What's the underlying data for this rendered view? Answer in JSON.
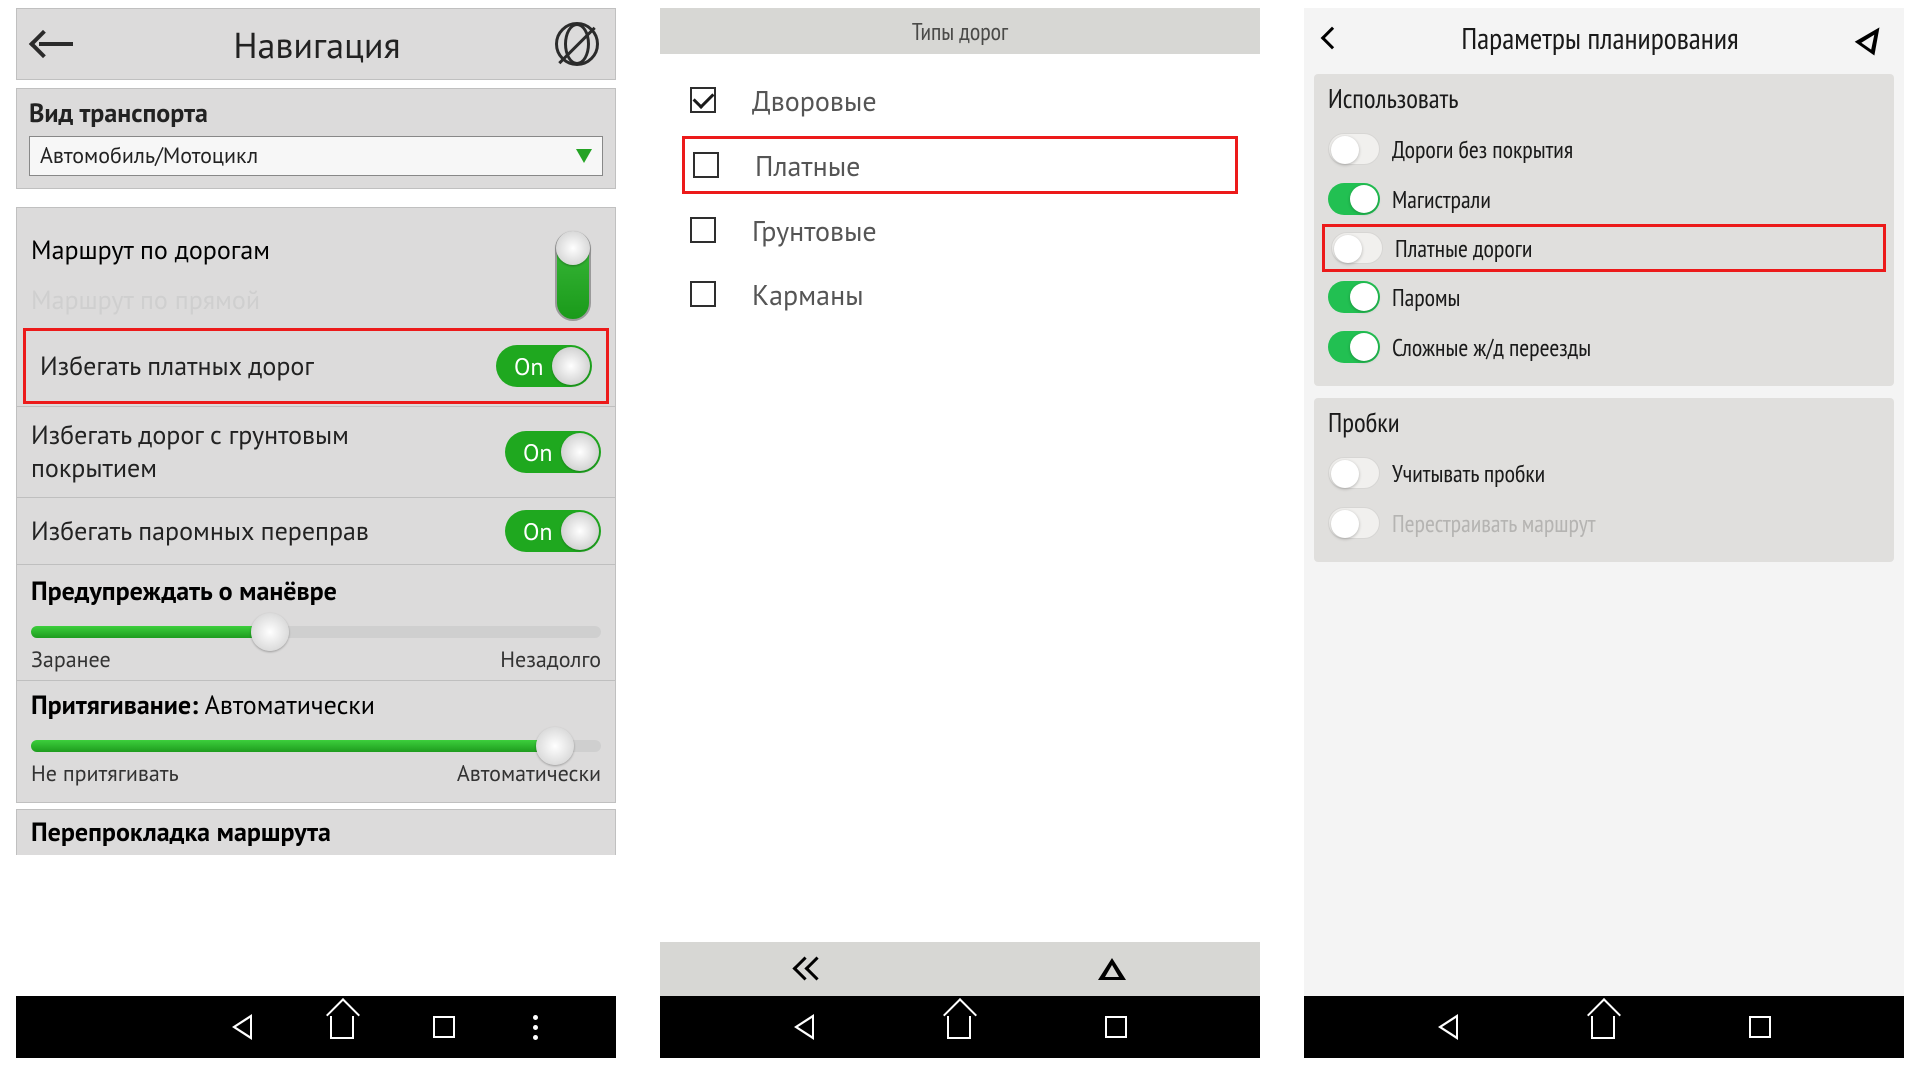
{
  "phone1": {
    "header": {
      "title": "Навигация"
    },
    "transport": {
      "section_title": "Вид транспорта",
      "value": "Автомобиль/Мотоцикл"
    },
    "route_mode": {
      "by_roads": "Маршрут по дорогам",
      "straight": "Маршрут по прямой"
    },
    "avoid": {
      "toll": {
        "label": "Избегать платных дорог",
        "toggle": "On"
      },
      "unpaved": {
        "label": "Избегать дорог с грунтовым покрытием",
        "toggle": "On"
      },
      "ferry": {
        "label": "Избегать паромных переправ",
        "toggle": "On"
      }
    },
    "maneuver": {
      "title": "Предупреждать о манёвре",
      "left": "Заранее",
      "right": "Незадолго",
      "value_pct": 42
    },
    "snap": {
      "title_prefix": "Притягивание: ",
      "title_value": "Автоматически",
      "left": "Не притягивать",
      "right": "Автоматически",
      "value_pct": 92
    },
    "next_section": "Перепрокладка маршрута"
  },
  "phone2": {
    "header": "Типы дорог",
    "items": [
      {
        "label": "Дворовые",
        "checked": true,
        "highlight": false
      },
      {
        "label": "Платные",
        "checked": false,
        "highlight": true
      },
      {
        "label": "Грунтовые",
        "checked": false,
        "highlight": false
      },
      {
        "label": "Карманы",
        "checked": false,
        "highlight": false
      }
    ]
  },
  "phone3": {
    "header": "Параметры планирования",
    "use": {
      "title": "Использовать",
      "options": [
        {
          "label": "Дороги без покрытия",
          "on": false,
          "highlight": false
        },
        {
          "label": "Магистрали",
          "on": true,
          "highlight": false
        },
        {
          "label": "Платные дороги",
          "on": false,
          "highlight": true
        },
        {
          "label": "Паромы",
          "on": true,
          "highlight": false
        },
        {
          "label": "Сложные ж/д переезды",
          "on": true,
          "highlight": false
        }
      ]
    },
    "traffic": {
      "title": "Пробки",
      "options": [
        {
          "label": "Учитывать пробки",
          "on": false,
          "dim": false
        },
        {
          "label": "Перестраивать маршрут",
          "on": false,
          "dim": true
        }
      ]
    }
  }
}
